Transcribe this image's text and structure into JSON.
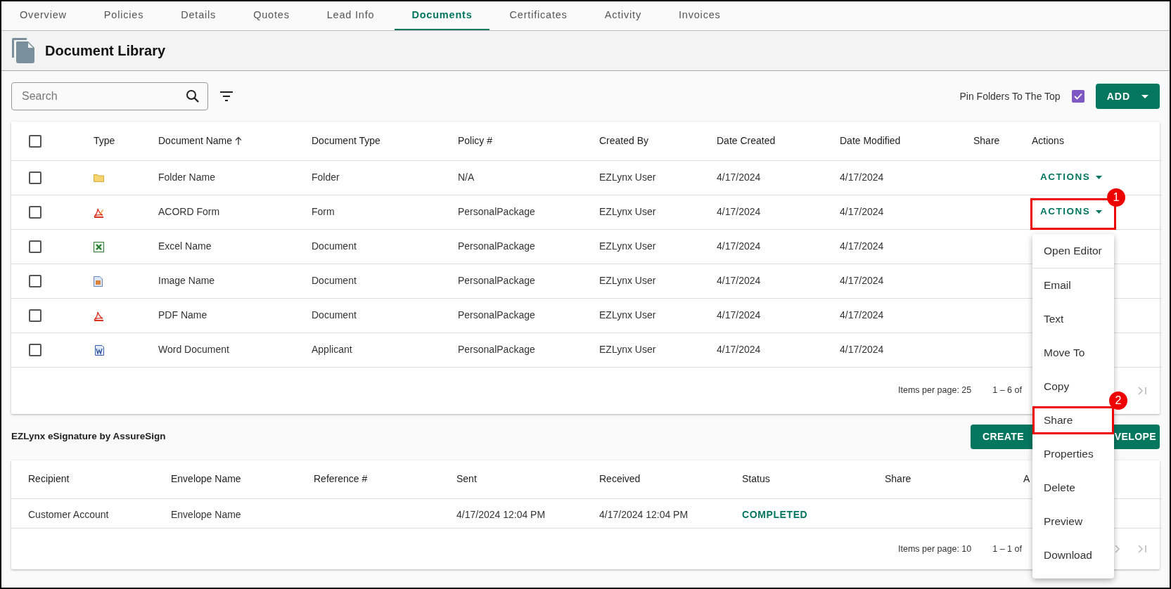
{
  "tabs": [
    {
      "label": "Overview",
      "selected": false
    },
    {
      "label": "Policies",
      "selected": false
    },
    {
      "label": "Details",
      "selected": false
    },
    {
      "label": "Quotes",
      "selected": false
    },
    {
      "label": "Lead Info",
      "selected": false
    },
    {
      "label": "Documents",
      "selected": true
    },
    {
      "label": "Certificates",
      "selected": false
    },
    {
      "label": "Activity",
      "selected": false
    },
    {
      "label": "Invoices",
      "selected": false
    }
  ],
  "page_title": "Document Library",
  "search": {
    "placeholder": "Search"
  },
  "pin_folders": {
    "label": "Pin Folders To The Top",
    "checked": true
  },
  "add_button": "ADD",
  "documents": {
    "select_all": {
      "checked": false
    },
    "columns": [
      "Type",
      "Document Name",
      "Document Type",
      "Policy #",
      "Created By",
      "Date Created",
      "Date Modified",
      "Share",
      "Actions"
    ],
    "rows": [
      {
        "selected": false,
        "kind": "folder",
        "name": "Folder Name",
        "document_type": "Folder",
        "policy": "N/A",
        "created_by": "EZLynx User",
        "date_created": "4/17/2024",
        "date_modified": "4/17/2024",
        "actions": "ACTIONS"
      },
      {
        "selected": false,
        "kind": "acord",
        "name": "ACORD Form",
        "document_type": "Form",
        "policy": "PersonalPackage",
        "created_by": "EZLynx User",
        "date_created": "4/17/2024",
        "date_modified": "4/17/2024",
        "actions": "ACTIONS"
      },
      {
        "selected": false,
        "kind": "excel",
        "name": "Excel Name",
        "document_type": "Document",
        "policy": "PersonalPackage",
        "created_by": "EZLynx User",
        "date_created": "4/17/2024",
        "date_modified": "4/17/2024"
      },
      {
        "selected": false,
        "kind": "image",
        "name": "Image Name",
        "document_type": "Document",
        "policy": "PersonalPackage",
        "created_by": "EZLynx User",
        "date_created": "4/17/2024",
        "date_modified": "4/17/2024"
      },
      {
        "selected": false,
        "kind": "pdf",
        "name": "PDF Name",
        "document_type": "Document",
        "policy": "PersonalPackage",
        "created_by": "EZLynx User",
        "date_created": "4/17/2024",
        "date_modified": "4/17/2024"
      },
      {
        "selected": false,
        "kind": "word",
        "name": "Word Document",
        "document_type": "Applicant",
        "policy": "PersonalPackage",
        "created_by": "EZLynx User",
        "date_created": "4/17/2024",
        "date_modified": "4/17/2024"
      }
    ],
    "items_per_page": "Items per page: 25",
    "range": "1 – 6 of"
  },
  "esignature": {
    "title": "EZLynx eSignature by AssureSign",
    "button_parts": [
      "CREATE",
      "VELOPE"
    ],
    "columns": [
      "Recipient",
      "Envelope Name",
      "Reference #",
      "Sent",
      "Received",
      "Status",
      "Share",
      "A"
    ],
    "rows": [
      {
        "recipient": "Customer Account",
        "envelope_name": "Envelope Name",
        "sent": "4/17/2024 12:04 PM",
        "received": "4/17/2024 12:04 PM",
        "status": "COMPLETED"
      }
    ],
    "items_per_page": "Items per page: 10",
    "range": "1 – 1 of"
  },
  "actions_menu": [
    {
      "label": "Open Editor",
      "separated": true
    },
    {
      "label": "Email",
      "separated": false
    },
    {
      "label": "Text",
      "separated": false
    },
    {
      "label": "Move To",
      "separated": false
    },
    {
      "label": "Copy",
      "separated": false
    },
    {
      "label": "Share",
      "separated": false
    },
    {
      "label": "Properties",
      "separated": false
    },
    {
      "label": "Delete",
      "separated": false
    },
    {
      "label": "Preview",
      "separated": false
    },
    {
      "label": "Download",
      "separated": false
    }
  ],
  "callouts": [
    {
      "number": "1"
    },
    {
      "number": "2"
    }
  ]
}
